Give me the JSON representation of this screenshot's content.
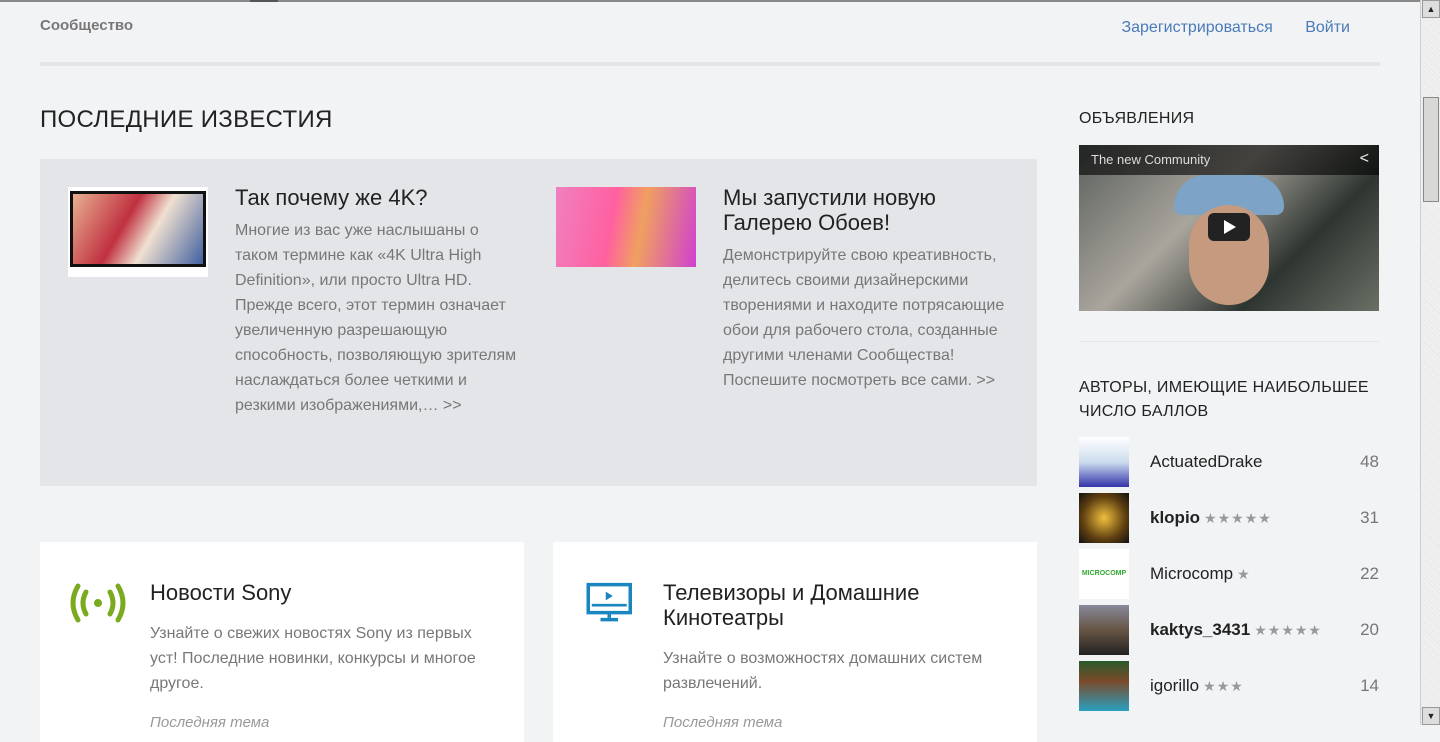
{
  "header": {
    "brand": "Сообщество",
    "register": "Зарегистрироваться",
    "login": "Войти"
  },
  "news": {
    "heading": "ПОСЛЕДНИЕ ИЗВЕСТИЯ",
    "articles": [
      {
        "title": "Так почему же 4K?",
        "text": "Многие из вас уже наслышаны о таком термине как «4K Ultra High Definition», или просто Ultra HD. Прежде всего, этот термин означает увеличенную разрешающую способность, позволяющую зрителям наслаждаться более четкими и резкими изображениями,… >>"
      },
      {
        "title": "Мы запустили новую Галерею Обоев!",
        "text": "Демонстрируйте свою креативность, делитесь своими дизайнерскими творениями и находите потрясающие обои для рабочего стола, созданные другими членами Сообщества! Поспешите посмотреть все сами. >>"
      }
    ]
  },
  "categories": [
    {
      "title": "Новости Sony",
      "text": "Узнайте о свежих новостях Sony из первых уст! Последние новинки, конкурсы и многое другое.",
      "last": "Последняя тема",
      "icon": "broadcast-icon",
      "color": "#7aab1e"
    },
    {
      "title": "Телевизоры и Домашние Кинотеатры",
      "text": "Узнайте о возможностях домашних систем развлечений.",
      "last": "Последняя тема",
      "icon": "tv-icon",
      "color": "#1a86c0"
    }
  ],
  "sidebar": {
    "ads_heading": "ОБЪЯВЛЕНИЯ",
    "video_title": "The new Community",
    "authors_heading": "АВТОРЫ, ИМЕЮЩИЕ НАИБОЛЬШЕЕ ЧИСЛО БАЛЛОВ",
    "authors": [
      {
        "name": "ActuatedDrake",
        "stars": "",
        "points": "48",
        "bold": false
      },
      {
        "name": "klopio",
        "stars": "★★★★★",
        "points": "31",
        "bold": true
      },
      {
        "name": "Microcomp",
        "stars": "★",
        "points": "22",
        "bold": false,
        "avatar_text": "MICROCOMP"
      },
      {
        "name": "kaktys_3431",
        "stars": "★★★★★",
        "points": "20",
        "bold": true
      },
      {
        "name": "igorillo",
        "stars": "★★★",
        "points": "14",
        "bold": false
      }
    ]
  }
}
